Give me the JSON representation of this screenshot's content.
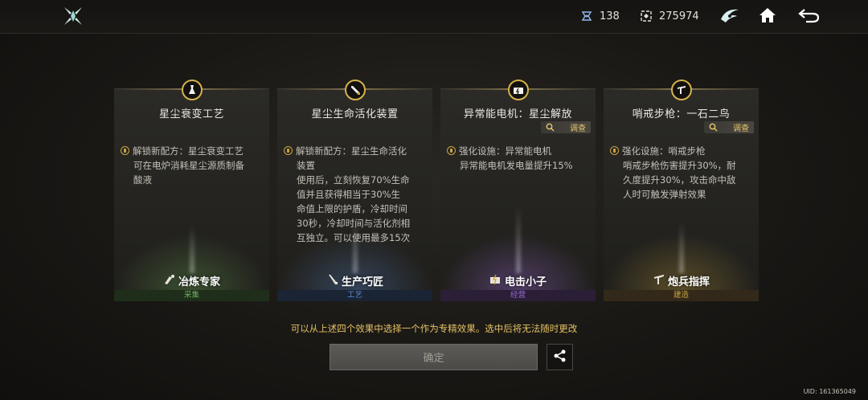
{
  "topbar": {
    "energy": "138",
    "currency": "275974"
  },
  "cards": [
    {
      "title": "星尘衰变工艺",
      "inspect": null,
      "lines": [
        "解锁新配方：星尘衰变工艺",
        "可在电炉消耗星尘源质制备",
        "酸液"
      ],
      "role": "冶炼专家",
      "category": "采集",
      "accent": "#6fae5a"
    },
    {
      "title": "星尘生命活化装置",
      "inspect": null,
      "lines": [
        "解锁新配方：星尘生命活化",
        "装置",
        "使用后，立刻恢复70%生命",
        "值并且获得相当于30%生",
        "命值上限的护盾，冷却时间",
        "30秒，冷却时间与活化剂相",
        "互独立。可以使用最多15次"
      ],
      "role": "生产巧匠",
      "category": "工艺",
      "accent": "#5a8ad0"
    },
    {
      "title": "异常能电机：星尘解放",
      "inspect": "调查",
      "lines": [
        "强化设施：异常能电机",
        "异常能电机发电量提升15%"
      ],
      "role": "电击小子",
      "category": "经营",
      "accent": "#9b6ad6"
    },
    {
      "title": "哨戒步枪：一石二鸟",
      "inspect": "调查",
      "lines": [
        "强化设施：哨戒步枪",
        "哨戒步枪伤害提升30%，耐",
        "久度提升30%，攻击命中敌",
        "人时可触发弹射效果"
      ],
      "role": "炮兵指挥",
      "category": "建造",
      "accent": "#c9a440"
    }
  ],
  "hint": "可以从上述四个效果中选择一个作为专精效果。选中后将无法随时更改",
  "confirm_label": "确定",
  "uid": "UID: 161365049"
}
